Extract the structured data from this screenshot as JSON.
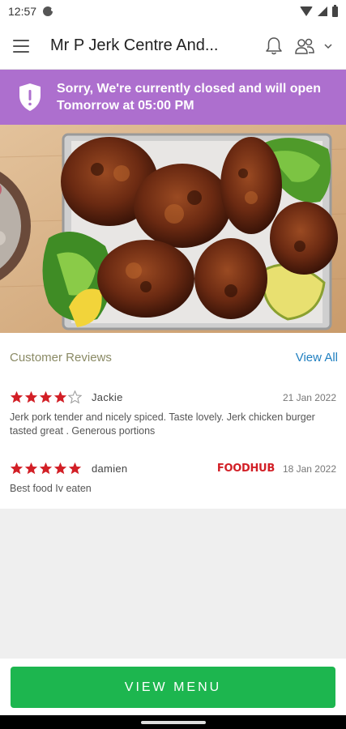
{
  "status_bar": {
    "time": "12:57"
  },
  "app_bar": {
    "title": "Mr P Jerk Centre And..."
  },
  "closed_banner": {
    "line1": "Sorry, We're currently closed and will open",
    "line2": "Tomorrow at 05:00 PM"
  },
  "reviews": {
    "title": "Customer Reviews",
    "view_all": "View All",
    "items": [
      {
        "rating": 4,
        "name": "Jackie",
        "source": "",
        "date": "21 Jan 2022",
        "text": "Jerk pork tender and nicely spiced. Taste lovely. Jerk chicken burger tasted great . Generous portions"
      },
      {
        "rating": 5,
        "name": "damien",
        "source": "FOODHUB",
        "date": "18 Jan 2022",
        "text": "Best food Iv eaten"
      }
    ]
  },
  "cta": {
    "label": "VIEW MENU"
  },
  "colors": {
    "banner": "#ad6fce",
    "star": "#d21f26",
    "cta": "#1db64f",
    "link": "#1f7fc0"
  }
}
